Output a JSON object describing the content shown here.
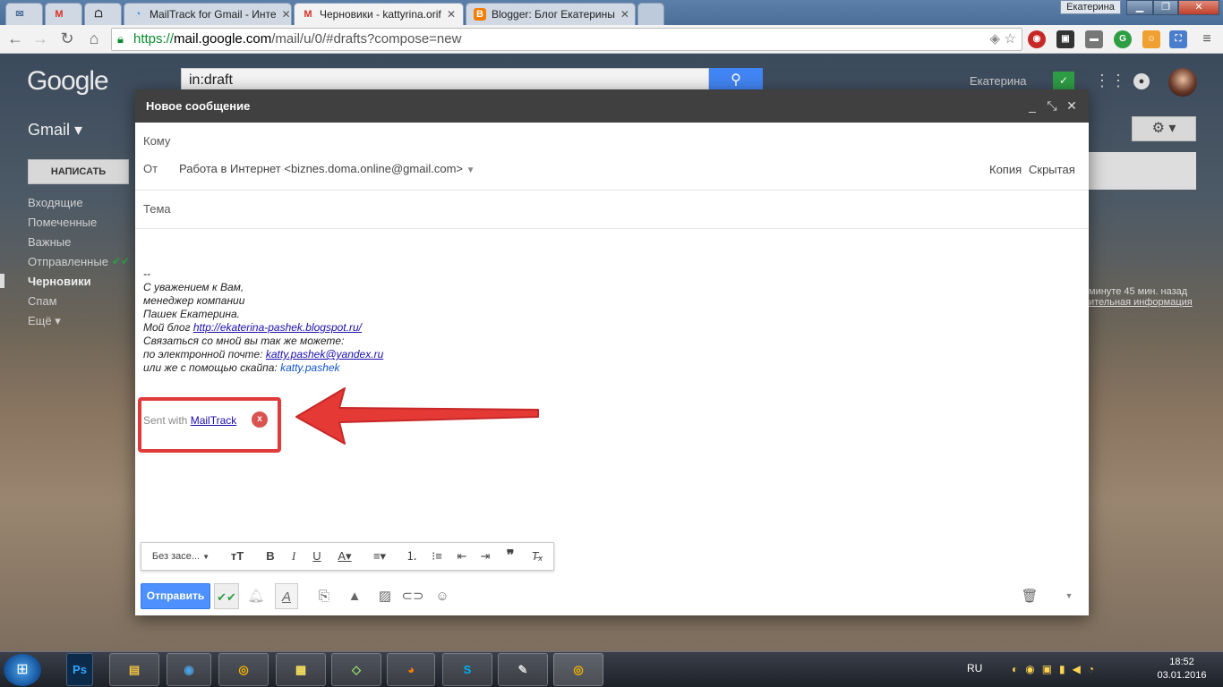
{
  "browser": {
    "tabs": [
      {
        "label": "",
        "icon": "inbox-icon"
      },
      {
        "label": "",
        "icon": "gmail-icon"
      },
      {
        "label": "",
        "icon": "bookmark-icon"
      },
      {
        "label": "MailTrack for Gmail - Инте",
        "icon": "mailtrack-icon"
      },
      {
        "label": "Черновики - kattyrina.orif",
        "icon": "gmail-icon"
      },
      {
        "label": "Blogger: Блог Екатерины",
        "icon": "blogger-icon"
      }
    ],
    "window_user": "Екатерина",
    "url_scheme": "https://",
    "url_host": "mail.google.com",
    "url_path": "/mail/u/0/#drafts?compose=new"
  },
  "gmail": {
    "logo": "Google",
    "search_query": "in:draft",
    "user_name": "Екатерина",
    "app_label": "Gmail ▾",
    "compose_button": "НАПИСАТЬ",
    "sidebar": [
      "Входящие",
      "Помеченные",
      "Важные",
      "Отправленные",
      "Черновики",
      "Спам",
      "Ещё ▾"
    ],
    "right_note_1": "минуте 45 мин. назад",
    "right_note_2": "ительная информация"
  },
  "compose": {
    "title": "Новое сообщение",
    "to_label": "Кому",
    "from_label": "От",
    "from_value": "Работа в Интернет <biznes.doma.online@gmail.com>",
    "cc_label": "Копия",
    "bcc_label": "Скрытая",
    "subject_label": "Тема",
    "signature": {
      "dash": "--",
      "line1": "С уважением к Вам,",
      "line2": "менеджер компании",
      "line3": "Пашек Екатерина.",
      "blog_prefix": "Мой блог ",
      "blog_link": "http://ekaterina-pashek.blogspot.ru/",
      "line5": "Связаться со мной вы так же можете:",
      "email_prefix": "по электронной почте: ",
      "email_link": "katty.pashek@yandex.ru",
      "skype_prefix": "или же с помощью скайпа: ",
      "skype_link": "katty.pashek"
    },
    "mailtrack_prefix": "Sent with ",
    "mailtrack_link": "MailTrack",
    "mailtrack_close": "x",
    "font_select": "Без засе...",
    "send_button": "Отправить"
  },
  "taskbar": {
    "lang": "RU",
    "time": "18:52",
    "date": "03.01.2016"
  },
  "colors": {
    "highlight_red": "#e03a3a",
    "send_blue": "#4d90fe",
    "compose_header": "#404040"
  }
}
